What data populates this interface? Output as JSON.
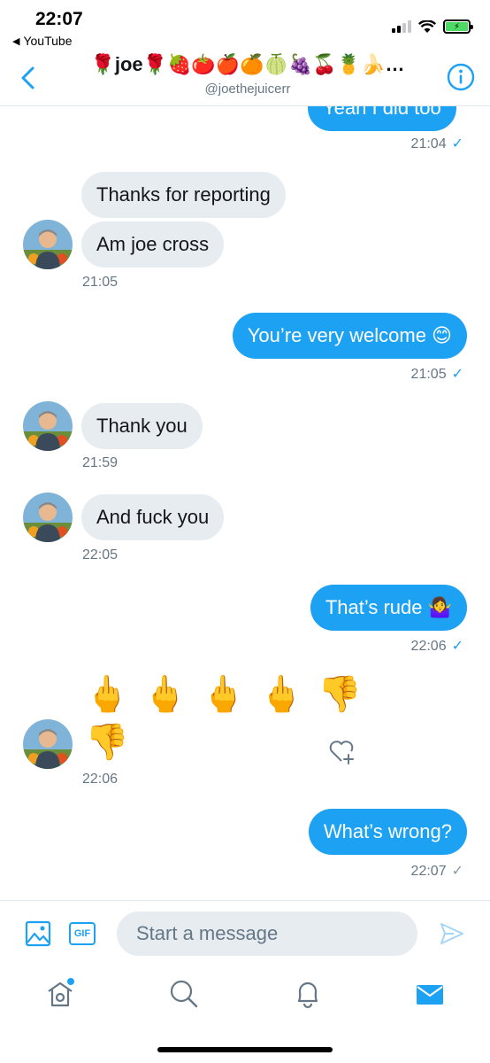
{
  "status_bar": {
    "time": "22:07",
    "back_app": "YouTube",
    "back_arrow": "◀"
  },
  "header": {
    "title": "🌹joe🌹🍓🍅🍎🍊🍈🍇🍒🍍🍌…",
    "handle": "@joethejuicerr",
    "back_icon": "chevron-left-icon",
    "info_icon": "info-icon"
  },
  "conversation": {
    "partial_message": "Yeah I did too",
    "partial_time": "21:04",
    "messages": [
      {
        "side": "in",
        "text": "Thanks for reporting"
      },
      {
        "side": "in",
        "text": "Am joe cross"
      },
      {
        "side": "in",
        "time": "21:05"
      },
      {
        "side": "out",
        "text": "You’re very welcome 😊",
        "time": "21:05"
      },
      {
        "side": "in",
        "text": "Thank you",
        "time": "21:59"
      },
      {
        "side": "in",
        "text": "And fuck you",
        "time": "22:05"
      },
      {
        "side": "out",
        "text": "That’s rude 🤷‍♀️",
        "time": "22:06"
      },
      {
        "side": "in",
        "emoji_line1": "🖕🖕🖕🖕👎",
        "emoji_line2": "👎",
        "time": "22:06"
      },
      {
        "side": "out",
        "text": "What’s wrong?",
        "time": "22:07"
      }
    ],
    "check_mark": "✓"
  },
  "compose": {
    "gif_label": "GIF",
    "placeholder": "Start a message"
  },
  "tabs": [
    {
      "name": "home",
      "icon": "home-icon"
    },
    {
      "name": "search",
      "icon": "search-icon"
    },
    {
      "name": "notifications",
      "icon": "bell-icon"
    },
    {
      "name": "messages",
      "icon": "mail-icon"
    }
  ],
  "colors": {
    "accent": "#1da1f2",
    "incoming_bubble": "#e6ecf0",
    "secondary_text": "#657786",
    "battery": "#4cd964"
  }
}
